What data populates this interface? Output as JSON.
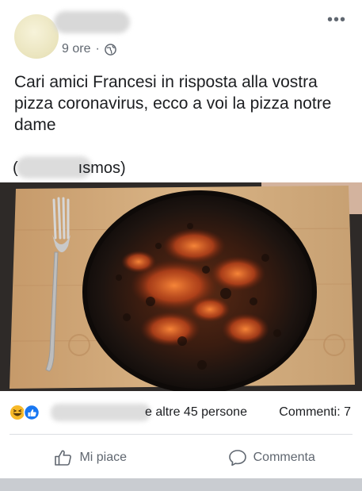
{
  "post": {
    "author_name": "",
    "time_label": "9 ore",
    "separator": "·",
    "more_icon": "more-dots-icon",
    "privacy_icon": "globe-icon",
    "text": "Cari amici Francesi in risposta alla vostra pizza coronavirus, ecco a voi la pizza notre dame",
    "mention_open": "(",
    "mention_tail": "ısmos)",
    "image_alt": "burnt pizza on a wooden board with a fork"
  },
  "reactions": {
    "icons": [
      "laugh-reaction-icon",
      "like-reaction-icon"
    ],
    "text": "e altre 45 persone",
    "comments": "Commenti: 7"
  },
  "actions": {
    "like_label": "Mi piace",
    "comment_label": "Commenta"
  },
  "colors": {
    "secondary_text": "#606770",
    "primary_text": "#1c1e21",
    "like_blue": "#1877f2",
    "haha_yellow": "#f7b928"
  }
}
